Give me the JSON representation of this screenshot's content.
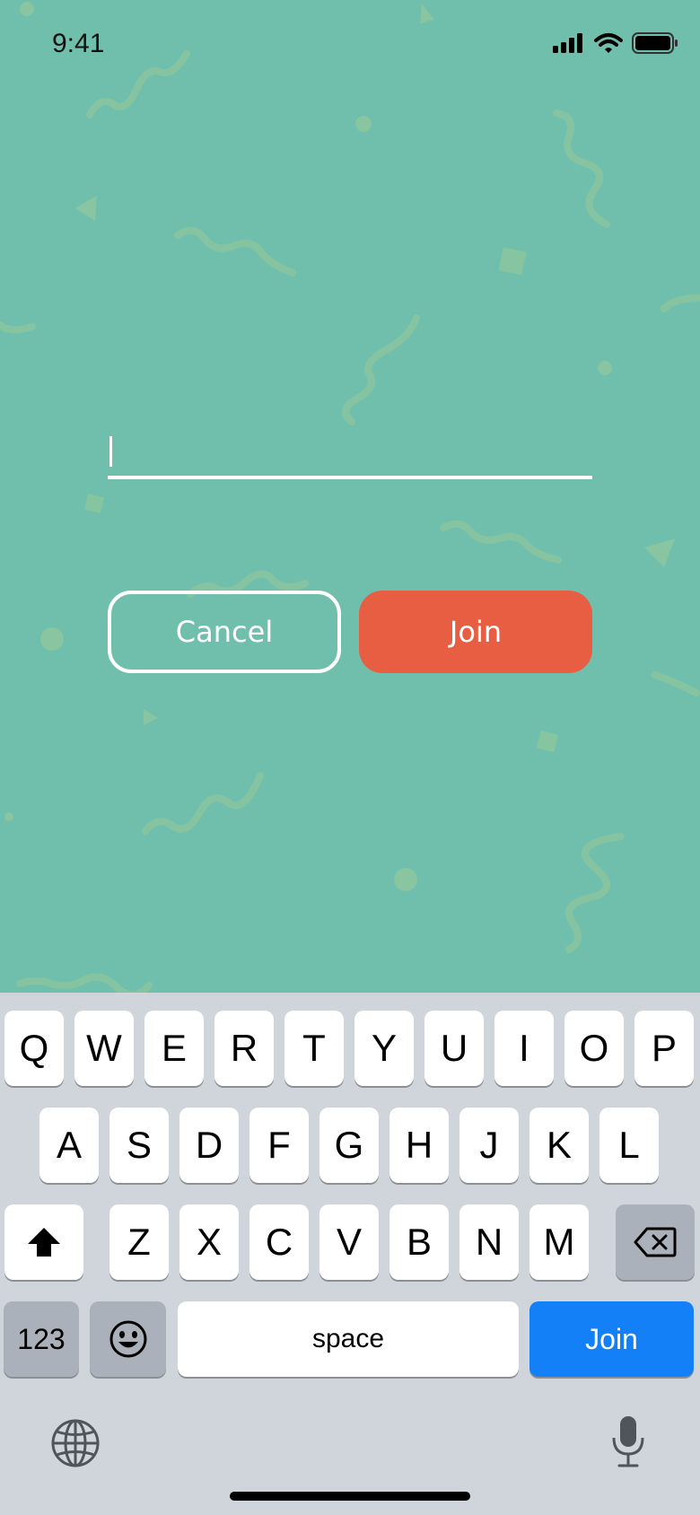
{
  "status_bar": {
    "time": "9:41"
  },
  "room_input": {
    "value": "",
    "placeholder": ""
  },
  "buttons": {
    "cancel": "Cancel",
    "join": "Join"
  },
  "colors": {
    "background": "#70BFAD",
    "join": "#E75E43",
    "keyboard": "#CFD5DB",
    "return_key": "#1480F7"
  },
  "keyboard": {
    "row1": [
      "Q",
      "W",
      "E",
      "R",
      "T",
      "Y",
      "U",
      "I",
      "O",
      "P"
    ],
    "row2": [
      "A",
      "S",
      "D",
      "F",
      "G",
      "H",
      "J",
      "K",
      "L"
    ],
    "row3": [
      "Z",
      "X",
      "C",
      "V",
      "B",
      "N",
      "M"
    ],
    "numbers_label": "123",
    "space_label": "space",
    "return_label": "Join"
  }
}
